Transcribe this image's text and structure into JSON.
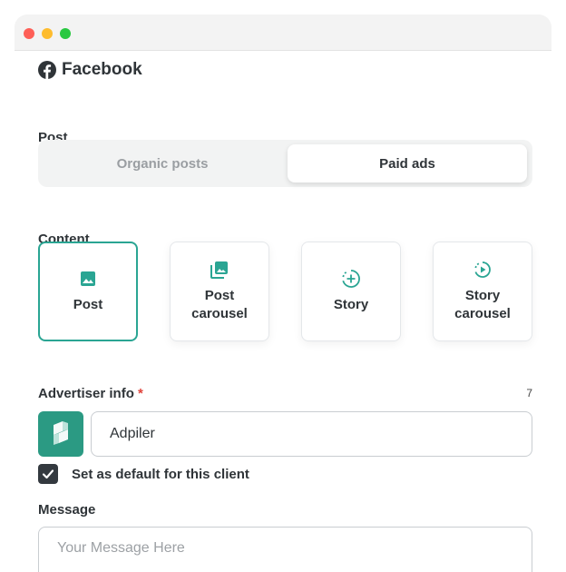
{
  "window": {
    "controls": [
      "close",
      "minimize",
      "maximize"
    ]
  },
  "platform": {
    "name": "Facebook",
    "icon": "facebook-icon"
  },
  "post_section": {
    "label": "Post",
    "options": [
      {
        "label": "Organic posts",
        "selected": false
      },
      {
        "label": "Paid ads",
        "selected": true
      }
    ]
  },
  "content_section": {
    "label": "Content",
    "cards": [
      {
        "line1": "Post",
        "line2": "",
        "icon": "image-icon",
        "selected": true
      },
      {
        "line1": "Post",
        "line2": "carousel",
        "icon": "image-stack-icon",
        "selected": false
      },
      {
        "line1": "Story",
        "line2": "",
        "icon": "story-add-icon",
        "selected": false
      },
      {
        "line1": "Story",
        "line2": "carousel",
        "icon": "story-carousel-icon",
        "selected": false
      }
    ]
  },
  "advertiser": {
    "label": "Advertiser info",
    "required_mark": "*",
    "counter": "7",
    "logo": "adpiler-logo",
    "value": "Adpiler"
  },
  "default_checkbox": {
    "checked": true,
    "label": "Set as default for this client"
  },
  "message": {
    "label": "Message",
    "placeholder": "Your Message Here",
    "value": ""
  },
  "colors": {
    "accent": "#2aa593",
    "required": "#e0433b",
    "logo_bg": "#2b9a83"
  }
}
